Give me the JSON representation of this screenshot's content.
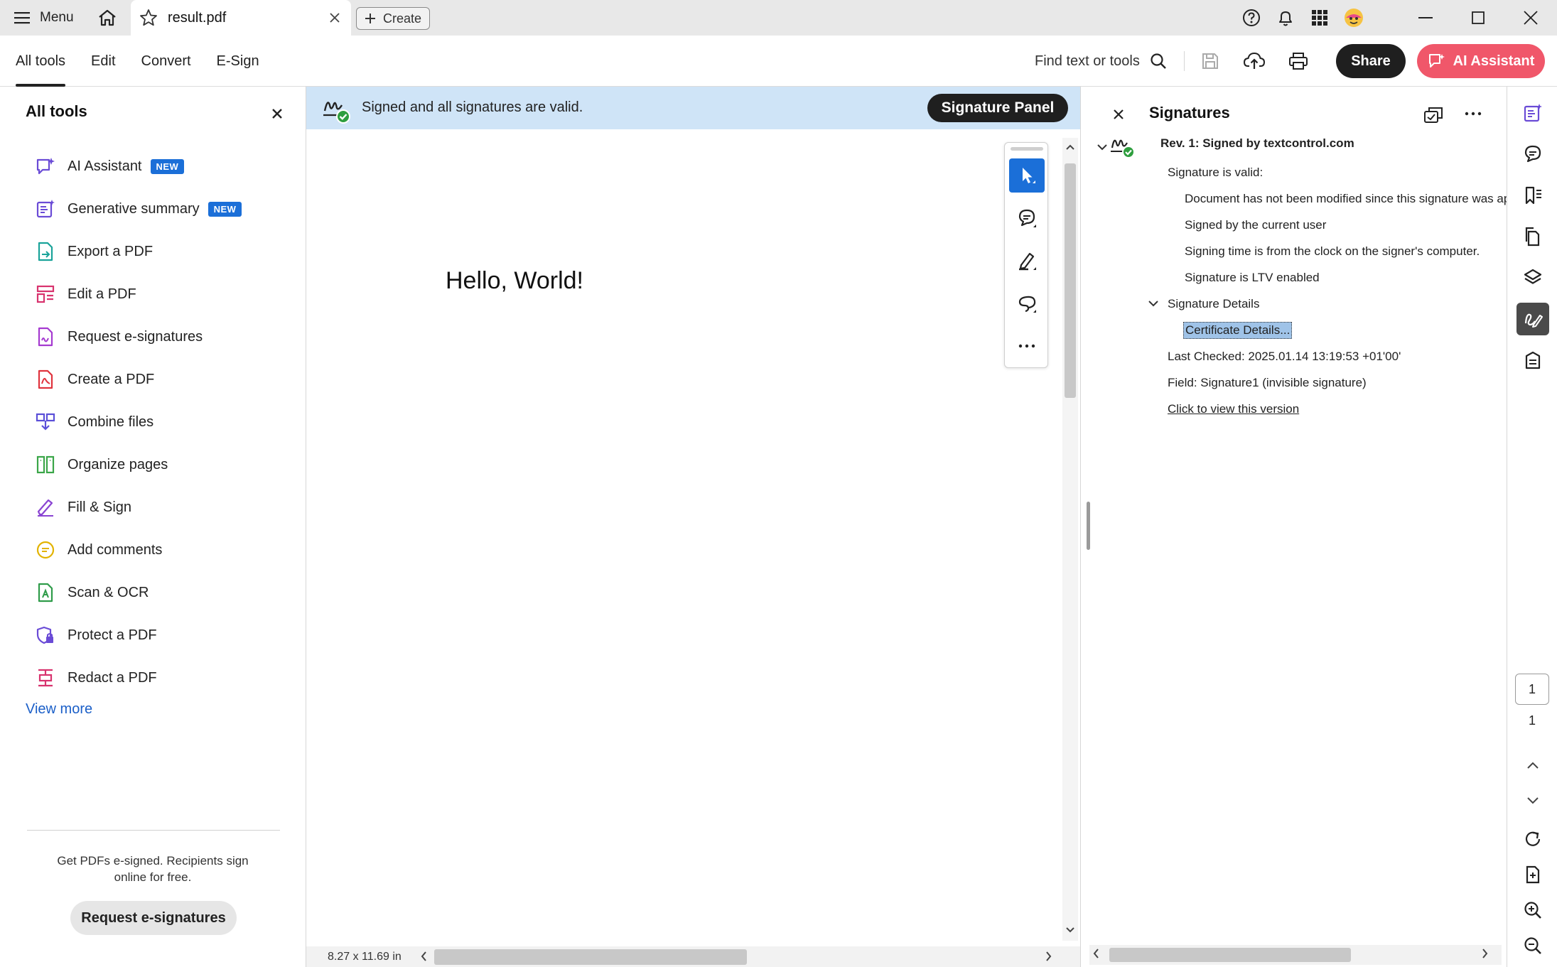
{
  "titlebar": {
    "menu_label": "Menu",
    "tab_name": "result.pdf",
    "create_label": "Create"
  },
  "toolbar": {
    "tabs": [
      "All tools",
      "Edit",
      "Convert",
      "E-Sign"
    ],
    "find_label": "Find text or tools",
    "share_label": "Share",
    "ai_label": "AI Assistant"
  },
  "left_panel": {
    "title": "All tools",
    "tools": [
      {
        "label": "AI Assistant",
        "badge": "NEW",
        "icon": "ai-assistant-icon",
        "color": "#6a4bd6"
      },
      {
        "label": "Generative summary",
        "badge": "NEW",
        "icon": "generative-summary-icon",
        "color": "#6a4bd6"
      },
      {
        "label": "Export a PDF",
        "icon": "export-pdf-icon",
        "color": "#1aa39a"
      },
      {
        "label": "Edit a PDF",
        "icon": "edit-pdf-icon",
        "color": "#d8336e"
      },
      {
        "label": "Request e-signatures",
        "icon": "request-esign-icon",
        "color": "#a53ad0"
      },
      {
        "label": "Create a PDF",
        "icon": "create-pdf-icon",
        "color": "#e0343e"
      },
      {
        "label": "Combine files",
        "icon": "combine-files-icon",
        "color": "#5b4fd8"
      },
      {
        "label": "Organize pages",
        "icon": "organize-pages-icon",
        "color": "#3aa648"
      },
      {
        "label": "Fill & Sign",
        "icon": "fill-sign-icon",
        "color": "#8a44d2"
      },
      {
        "label": "Add comments",
        "icon": "add-comments-icon",
        "color": "#e2b300"
      },
      {
        "label": "Scan & OCR",
        "icon": "scan-ocr-icon",
        "color": "#2f9c4a"
      },
      {
        "label": "Protect a PDF",
        "icon": "protect-pdf-icon",
        "color": "#6a4bd6"
      },
      {
        "label": "Redact a PDF",
        "icon": "redact-pdf-icon",
        "color": "#d8336e"
      }
    ],
    "view_more": "View more",
    "promo_text": "Get PDFs e-signed. Recipients sign online for free.",
    "promo_button": "Request e-signatures"
  },
  "document": {
    "banner_text": "Signed and all signatures are valid.",
    "signature_panel_button": "Signature Panel",
    "page_text": "Hello, World!",
    "page_size": "8.27 x 11.69 in"
  },
  "signatures_panel": {
    "title": "Signatures",
    "revision": "Rev. 1: Signed by textcontrol.com",
    "status": "Signature is valid:",
    "details": [
      "Document has not been modified since this signature was applie",
      "Signed by the current user",
      "Signing time is from the clock on the signer's computer.",
      "Signature is LTV enabled"
    ],
    "details_header": "Signature Details",
    "certificate_details": "Certificate Details...",
    "last_checked": "Last Checked: 2025.01.14 13:19:53 +01'00'",
    "field": "Field: Signature1 (invisible signature)",
    "view_version_link": "Click to view this version"
  },
  "rail": {
    "current_page": "1",
    "total_pages": "1"
  },
  "colors": {
    "accent_blue": "#1b6fd8",
    "banner_bg": "#cfe4f7",
    "ai_button": "#f0576a",
    "dark_button": "#1f1f1f",
    "valid_green": "#2e9e3e"
  }
}
